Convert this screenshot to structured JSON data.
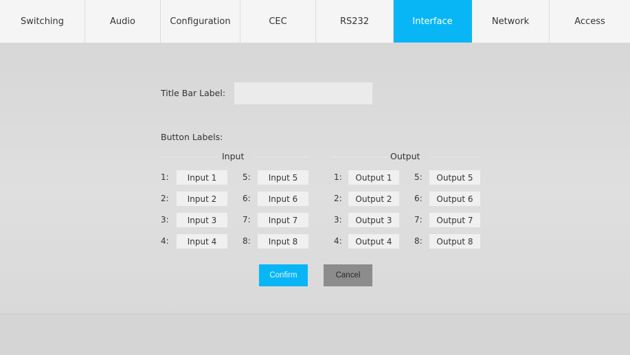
{
  "tabs": [
    {
      "label": "Switching",
      "active": false
    },
    {
      "label": "Audio",
      "active": false
    },
    {
      "label": "Configuration",
      "active": false
    },
    {
      "label": "CEC",
      "active": false
    },
    {
      "label": "RS232",
      "active": false
    },
    {
      "label": "Interface",
      "active": true
    },
    {
      "label": "Network",
      "active": false
    },
    {
      "label": "Access",
      "active": false
    }
  ],
  "form": {
    "title_bar_label": "Title Bar Label:",
    "title_bar_value": "",
    "button_labels": "Button Labels:",
    "input_heading": "Input",
    "output_heading": "Output"
  },
  "inputs": [
    {
      "num": "1:",
      "value": "Input 1"
    },
    {
      "num": "2:",
      "value": "Input 2"
    },
    {
      "num": "3:",
      "value": "Input 3"
    },
    {
      "num": "4:",
      "value": "Input 4"
    },
    {
      "num": "5:",
      "value": "Input 5"
    },
    {
      "num": "6:",
      "value": "Input 6"
    },
    {
      "num": "7:",
      "value": "Input 7"
    },
    {
      "num": "8:",
      "value": "Input 8"
    }
  ],
  "outputs": [
    {
      "num": "1:",
      "value": "Output 1"
    },
    {
      "num": "2:",
      "value": "Output 2"
    },
    {
      "num": "3:",
      "value": "Output 3"
    },
    {
      "num": "4:",
      "value": "Output 4"
    },
    {
      "num": "5:",
      "value": "Output 5"
    },
    {
      "num": "6:",
      "value": "Output 6"
    },
    {
      "num": "7:",
      "value": "Output 7"
    },
    {
      "num": "8:",
      "value": "Output 8"
    }
  ],
  "actions": {
    "confirm": "Confirm",
    "cancel": "Cancel"
  },
  "colors": {
    "accent": "#08b6f5",
    "cancel": "#8c8c8c"
  }
}
